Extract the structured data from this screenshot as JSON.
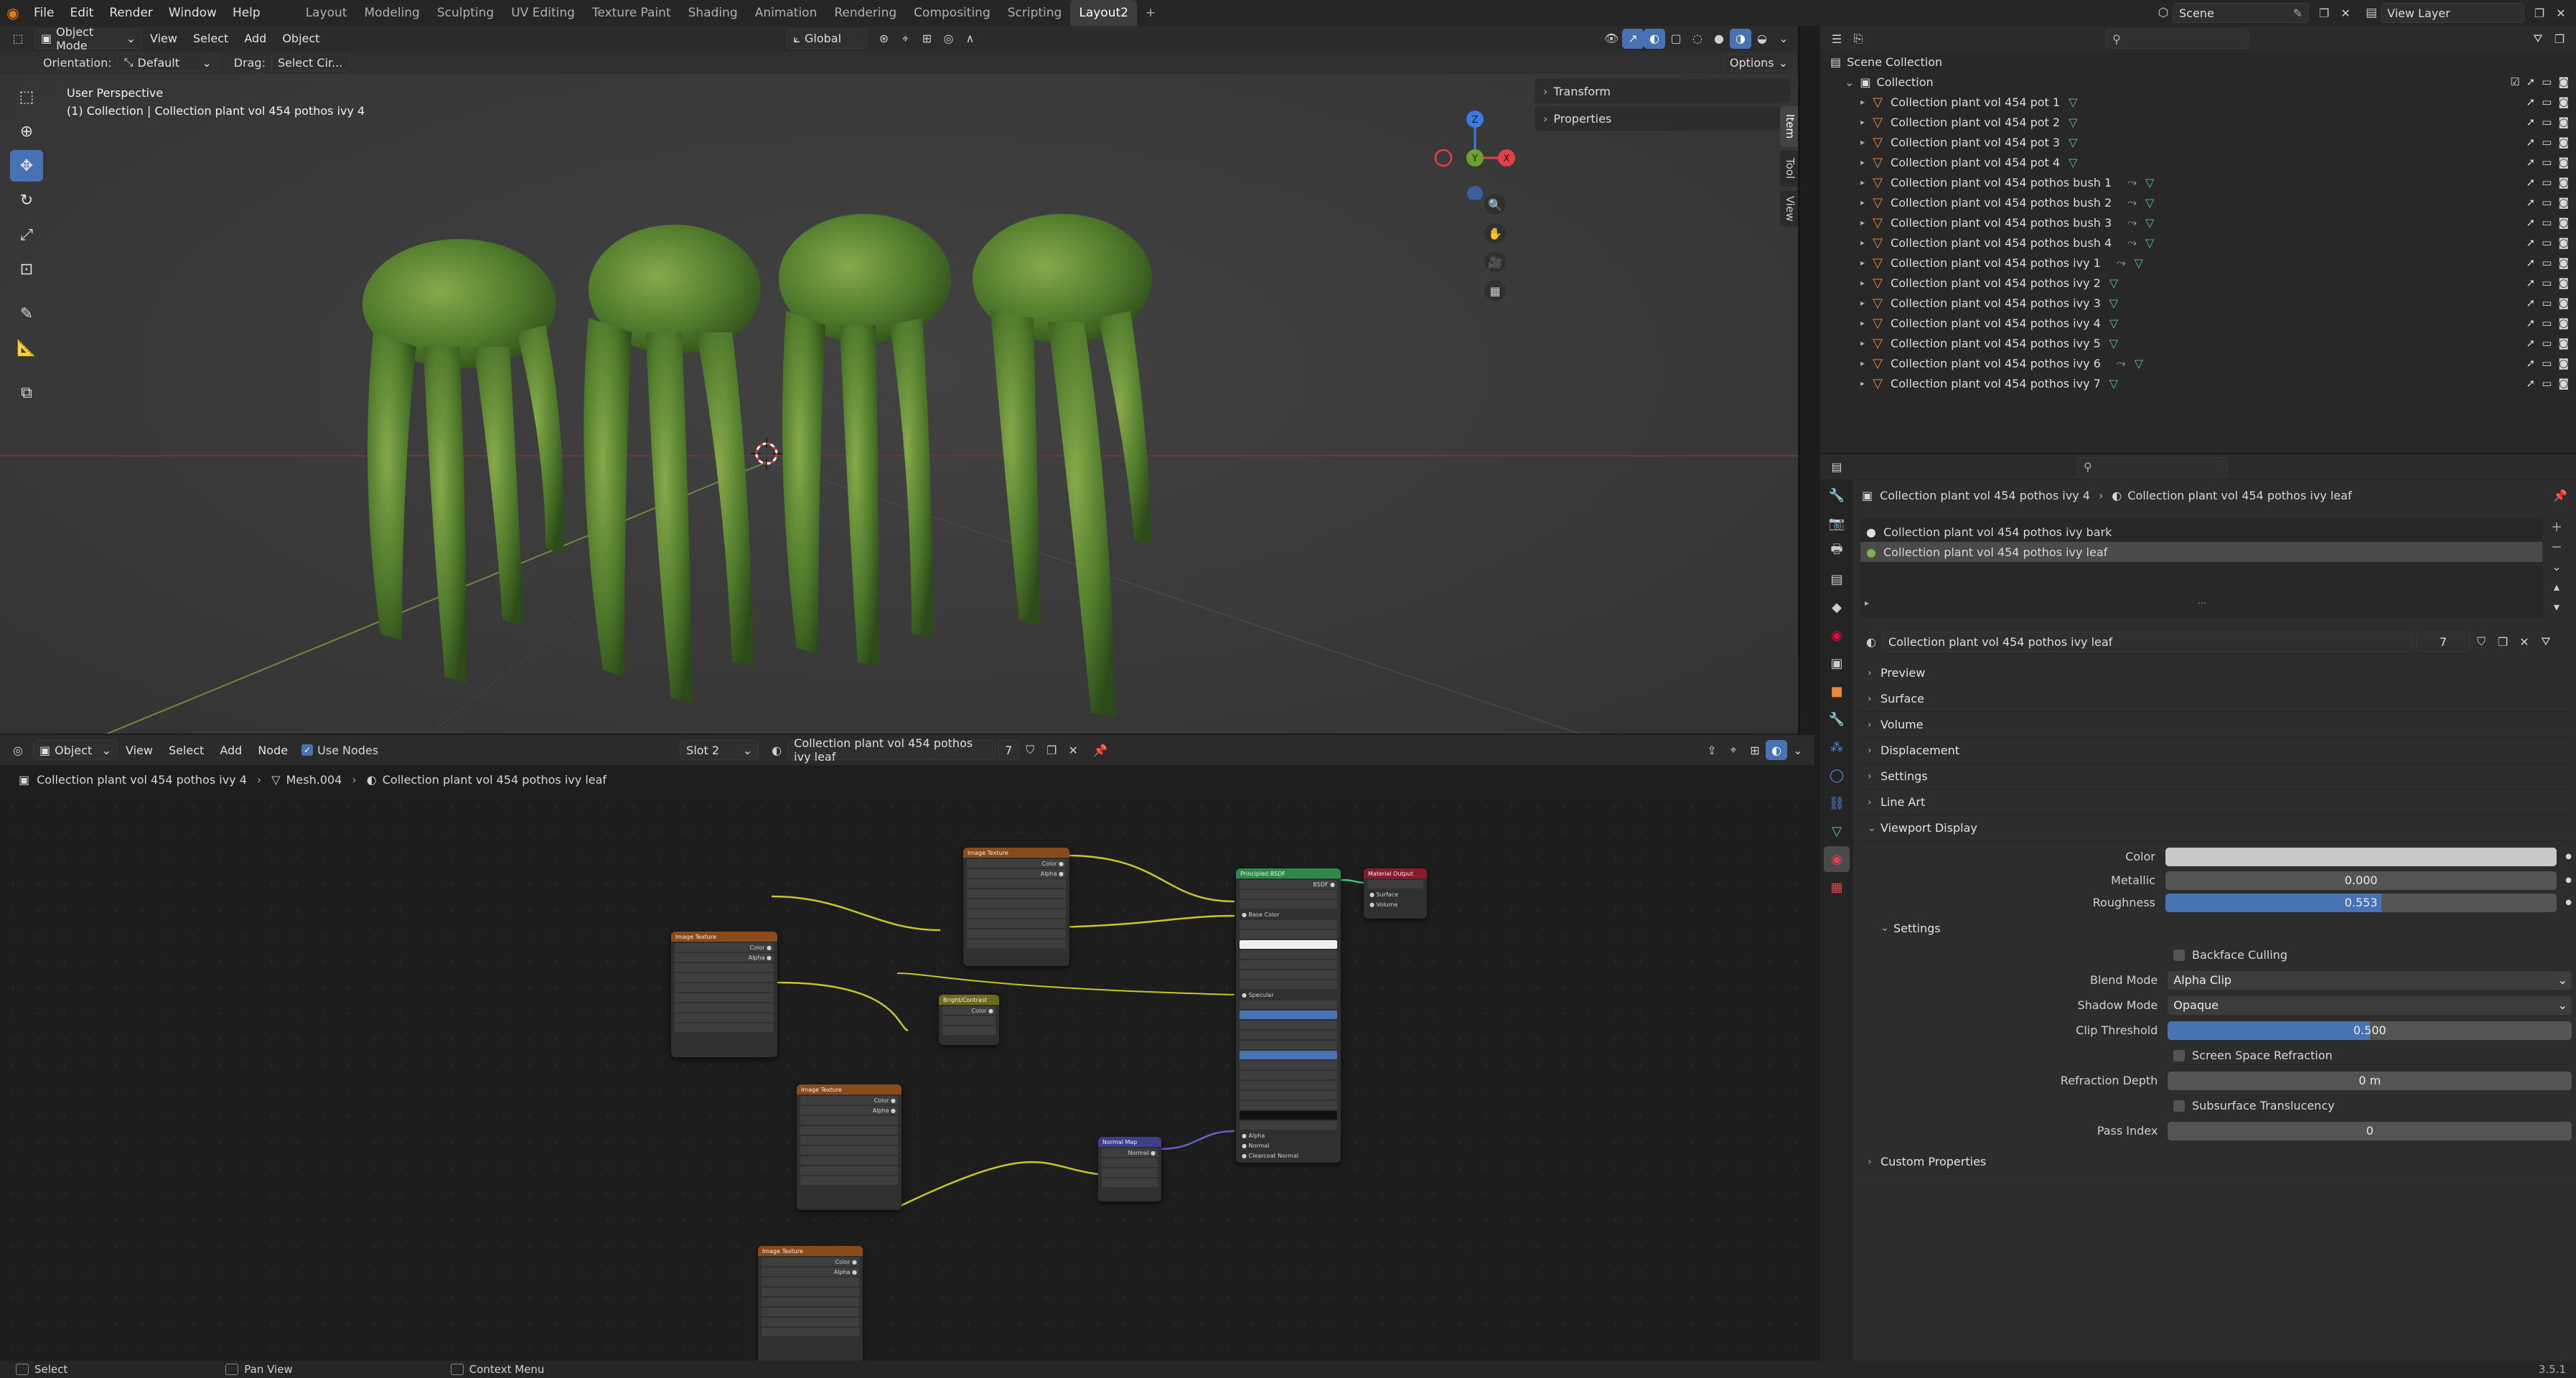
{
  "top_menu": {
    "logo": "blender-logo",
    "items": [
      "File",
      "Edit",
      "Render",
      "Window",
      "Help"
    ],
    "workspaces": [
      "Layout",
      "Modeling",
      "Sculpting",
      "UV Editing",
      "Texture Paint",
      "Shading",
      "Animation",
      "Rendering",
      "Compositing",
      "Scripting",
      "Layout2"
    ],
    "active_workspace": "Layout2",
    "add_workspace": "+",
    "scene_name": "Scene",
    "view_layer": "View Layer"
  },
  "viewport": {
    "mode": "Object Mode",
    "menus": [
      "View",
      "Select",
      "Add",
      "Object"
    ],
    "transform_orientation": "Global",
    "orientation_label": "Orientation:",
    "orientation_value": "Default",
    "drag_label": "Drag:",
    "drag_value": "Select Cir...",
    "options": "Options",
    "overlay_title": "User Perspective",
    "overlay_subtitle": "(1) Collection | Collection plant vol 454 pothos ivy 4",
    "npanel_sections": [
      "Transform",
      "Properties"
    ],
    "side_tabs": [
      "Item",
      "Tool",
      "View"
    ],
    "gizmo_axes": {
      "x": "X",
      "y": "Y",
      "z": "Z"
    },
    "axis_colors": {
      "x": "#e0414b",
      "y": "#6ea032",
      "z": "#3c7ae0"
    }
  },
  "node_editor": {
    "type": "Object",
    "menus": [
      "View",
      "Select",
      "Add",
      "Node"
    ],
    "use_nodes_label": "Use Nodes",
    "slot": "Slot 2",
    "material": "Collection plant vol 454 pothos ivy leaf",
    "users": "7",
    "breadcrumb": [
      "Collection plant vol 454 pothos ivy 4",
      "Mesh.004",
      "Collection plant vol 454 pothos ivy leaf"
    ]
  },
  "outliner": {
    "search_placeholder": "",
    "root": "Scene Collection",
    "collection": "Collection",
    "items": [
      {
        "name": "Collection plant vol 454 pot 1",
        "mod": false
      },
      {
        "name": "Collection plant vol 454 pot 2",
        "mod": false
      },
      {
        "name": "Collection plant vol 454 pot 3",
        "mod": false
      },
      {
        "name": "Collection plant vol 454 pot 4",
        "mod": false
      },
      {
        "name": "Collection plant vol 454 pothos bush 1",
        "mod": true
      },
      {
        "name": "Collection plant vol 454 pothos bush 2",
        "mod": true
      },
      {
        "name": "Collection plant vol 454 pothos bush 3",
        "mod": true
      },
      {
        "name": "Collection plant vol 454 pothos bush 4",
        "mod": true
      },
      {
        "name": "Collection plant vol 454 pothos ivy 1",
        "mod": true
      },
      {
        "name": "Collection plant vol 454 pothos ivy 2",
        "mod": false
      },
      {
        "name": "Collection plant vol 454 pothos ivy 3",
        "mod": false
      },
      {
        "name": "Collection plant vol 454 pothos ivy 4",
        "mod": false
      },
      {
        "name": "Collection plant vol 454 pothos ivy 5",
        "mod": false
      },
      {
        "name": "Collection plant vol 454 pothos ivy 6",
        "mod": true
      },
      {
        "name": "Collection plant vol 454 pothos ivy 7",
        "mod": false
      }
    ]
  },
  "properties": {
    "breadcrumb_object": "Collection plant vol 454 pothos ivy 4",
    "breadcrumb_material": "Collection plant vol 454 pothos ivy leaf",
    "slots": [
      "Collection plant vol 454 pothos ivy bark",
      "Collection plant vol 454 pothos ivy leaf"
    ],
    "material_name": "Collection plant vol 454 pothos ivy leaf",
    "users": "7",
    "sections": [
      "Preview",
      "Surface",
      "Volume",
      "Displacement",
      "Settings",
      "Line Art"
    ],
    "viewport_display": "Viewport Display",
    "color_label": "Color",
    "metallic_label": "Metallic",
    "metallic_value": "0.000",
    "roughness_label": "Roughness",
    "roughness_value": "0.553",
    "roughness_fraction": 0.553,
    "settings_sub": "Settings",
    "backface_culling": "Backface Culling",
    "blend_mode_label": "Blend Mode",
    "blend_mode_value": "Alpha Clip",
    "shadow_mode_label": "Shadow Mode",
    "shadow_mode_value": "Opaque",
    "clip_threshold_label": "Clip Threshold",
    "clip_threshold_value": "0.500",
    "clip_threshold_fraction": 0.5,
    "ssr_label": "Screen Space Refraction",
    "refraction_depth_label": "Refraction Depth",
    "refraction_depth_value": "0 m",
    "sss_label": "Subsurface Translucency",
    "pass_index_label": "Pass Index",
    "pass_index_value": "0",
    "custom_props": "Custom Properties"
  },
  "status_bar": {
    "select": "Select",
    "pan_view": "Pan View",
    "context_menu": "Context Menu",
    "version": "3.5.1"
  },
  "colors": {
    "accent": "#4772b3",
    "selection": "#334d80",
    "mesh_icon": "#5fc0a8",
    "object_icon": "#e8883c"
  }
}
